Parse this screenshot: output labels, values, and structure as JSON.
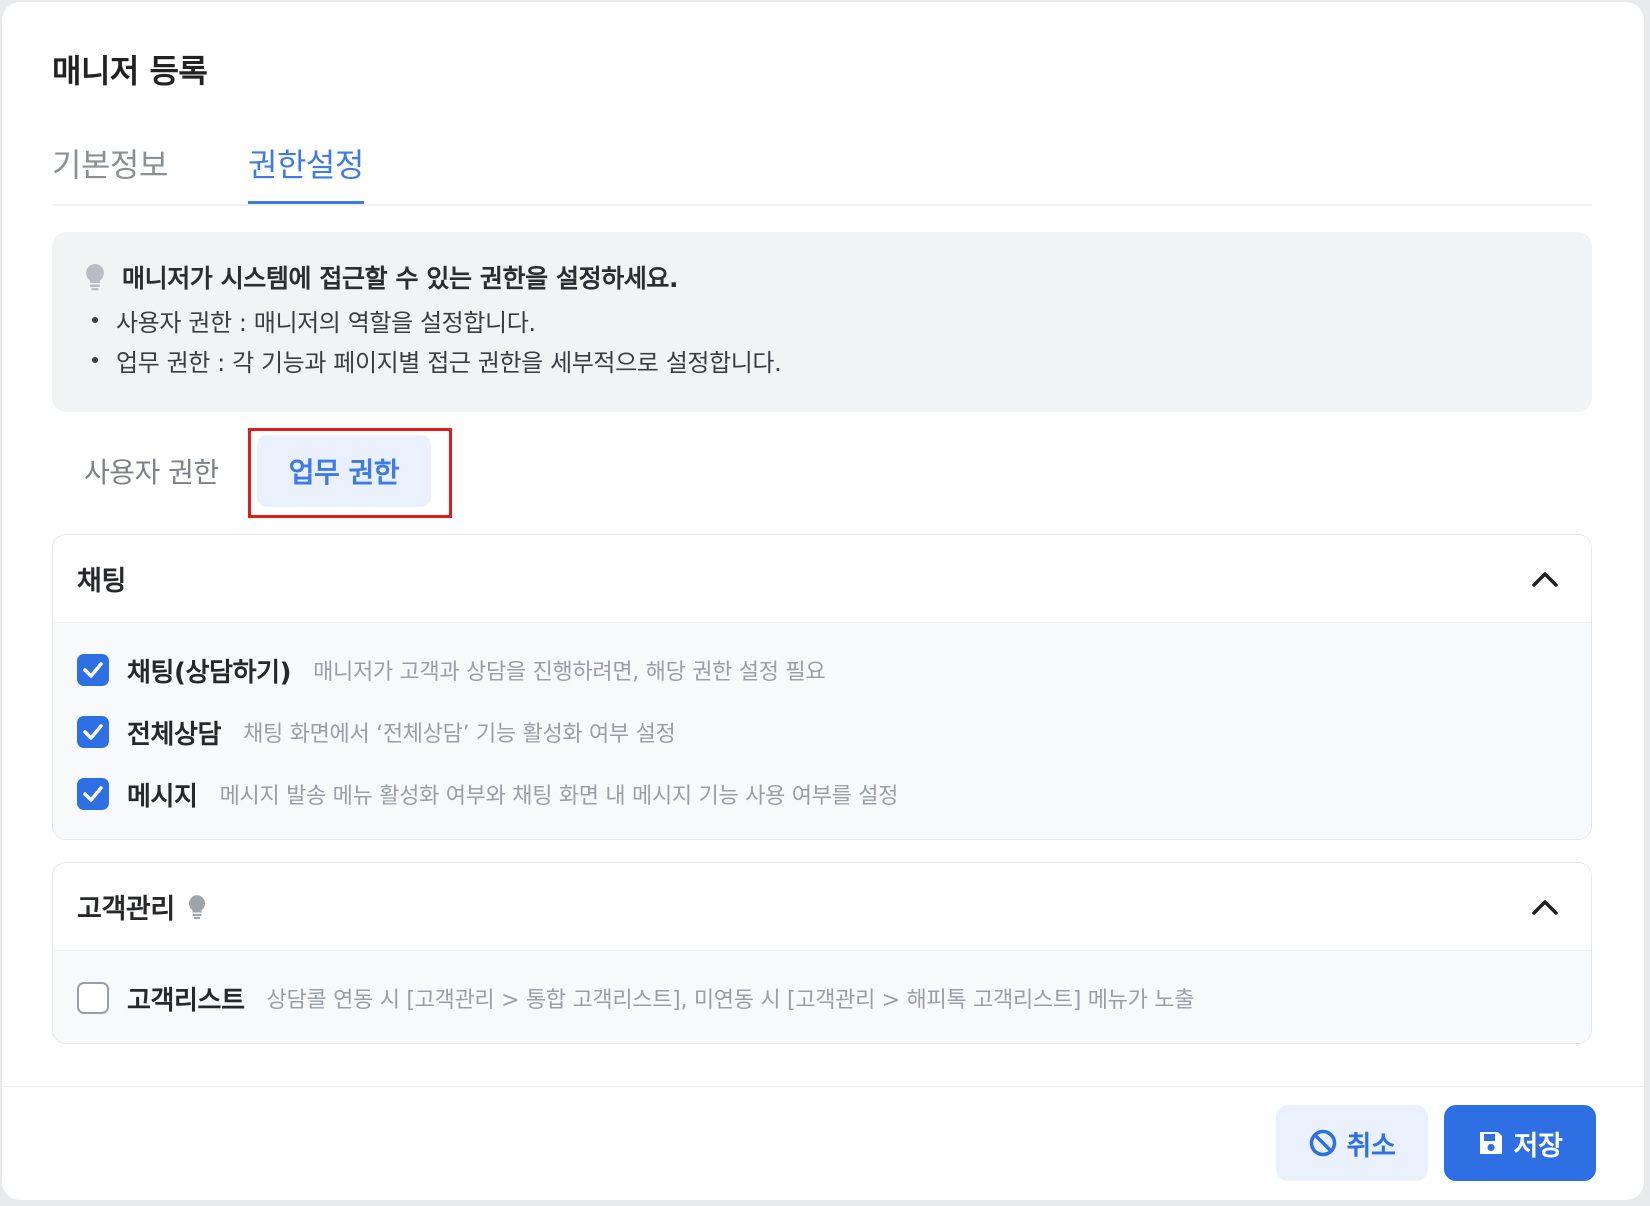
{
  "modal": {
    "title": "매니저 등록",
    "tabs": [
      {
        "label": "기본정보",
        "active": false
      },
      {
        "label": "권한설정",
        "active": true
      }
    ]
  },
  "info": {
    "headline": "매니저가 시스템에 접근할 수 있는 권한을 설정하세요.",
    "items": [
      "사용자 권한 : 매니저의 역할을 설정합니다.",
      "업무 권한 : 각 기능과 페이지별 접근 권한을 세부적으로 설정합니다."
    ]
  },
  "subtabs": {
    "user_label": "사용자 권한",
    "work_label": "업무 권한",
    "active": "work"
  },
  "sections": [
    {
      "title": "채팅",
      "expanded": true,
      "items": [
        {
          "label": "채팅(상담하기)",
          "desc": "매니저가 고객과 상담을 진행하려면, 해당 권한 설정 필요",
          "checked": true
        },
        {
          "label": "전체상담",
          "desc": "채팅 화면에서 ‘전체상담’ 기능 활성화 여부 설정",
          "checked": true
        },
        {
          "label": "메시지",
          "desc": "메시지 발송 메뉴 활성화 여부와 채팅 화면 내 메시지 기능 사용 여부를 설정",
          "checked": true
        }
      ]
    },
    {
      "title": "고객관리",
      "expanded": true,
      "items": [
        {
          "label": "고객리스트",
          "desc": "상담콜 연동 시 [고객관리 > 통합 고객리스트], 미연동 시 [고객관리 > 해피톡 고객리스트] 메뉴가 노출",
          "checked": false
        }
      ]
    }
  ],
  "footer": {
    "cancel_label": "취소",
    "save_label": "저장"
  },
  "colors": {
    "accent": "#2f6fe4",
    "highlight": "#e01b1b"
  },
  "icons": [
    "lightbulb-icon",
    "chevron-up-icon",
    "check-icon",
    "ban-icon",
    "save-icon"
  ]
}
